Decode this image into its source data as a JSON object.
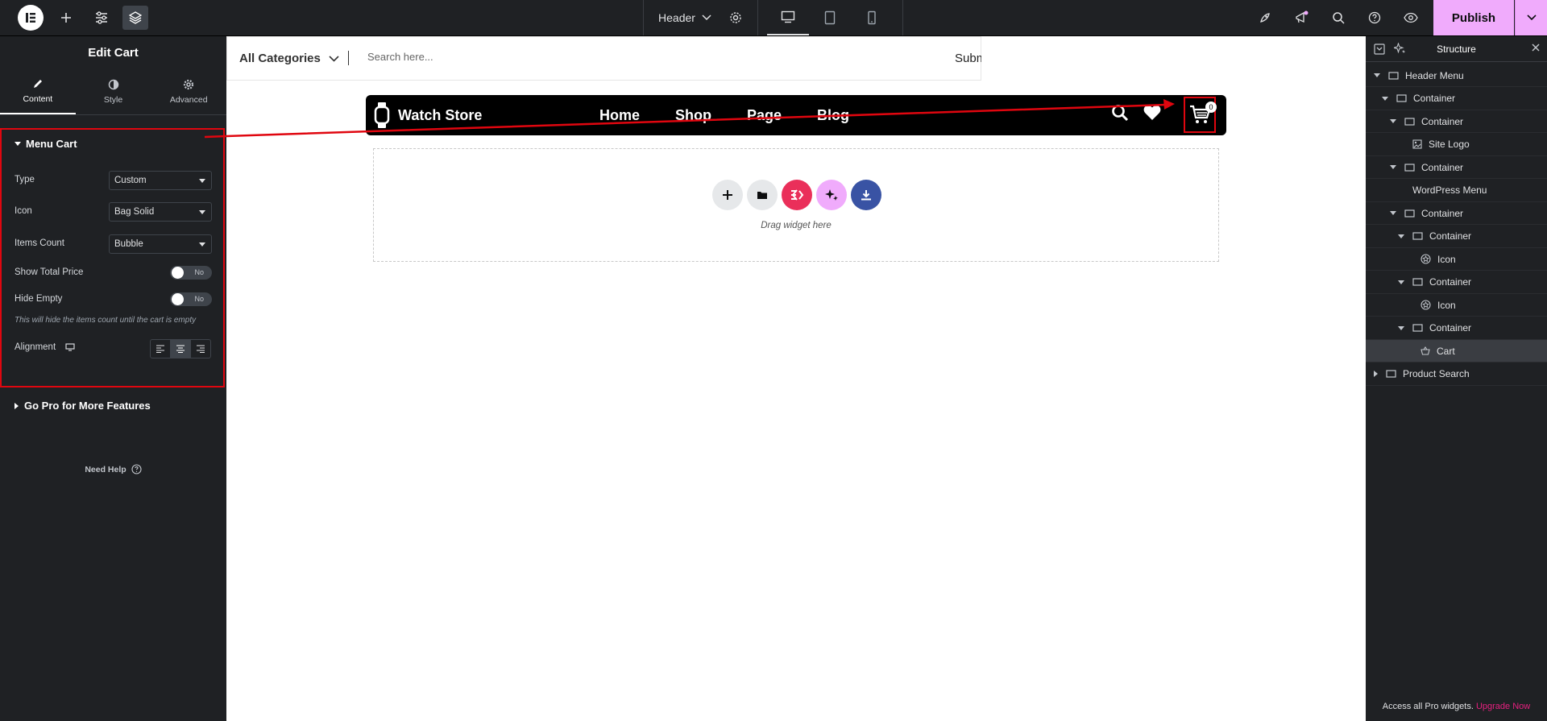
{
  "topbar": {
    "document_name": "Header",
    "publish_label": "Publish"
  },
  "panel": {
    "title": "Edit Cart",
    "tabs": [
      {
        "label": "Content",
        "icon": "pencil-icon",
        "active": true
      },
      {
        "label": "Style",
        "icon": "half-circle-icon",
        "active": false
      },
      {
        "label": "Advanced",
        "icon": "gear-icon",
        "active": false
      }
    ],
    "section_title": "Menu Cart",
    "controls": {
      "type_label": "Type",
      "type_value": "Custom",
      "icon_label": "Icon",
      "icon_value": "Bag Solid",
      "items_count_label": "Items Count",
      "items_count_value": "Bubble",
      "show_total_price_label": "Show Total Price",
      "show_total_price_value": "No",
      "hide_empty_label": "Hide Empty",
      "hide_empty_value": "No",
      "hide_empty_description": "This will hide the items count until the cart is empty",
      "alignment_label": "Alignment"
    },
    "gopro_label": "Go Pro for More Features",
    "need_help_label": "Need Help"
  },
  "canvas": {
    "search": {
      "category": "All Categories",
      "placeholder": "Search here...",
      "submit": "Submit"
    },
    "header": {
      "store_name": "Watch Store",
      "nav": [
        "Home",
        "Shop",
        "Page",
        "Blog"
      ],
      "cart_count": "0"
    },
    "drop_text": "Drag widget here"
  },
  "structure": {
    "title": "Structure",
    "nodes": [
      {
        "label": "Header Menu",
        "depth": 0,
        "caret": "down",
        "icon": "container-icon"
      },
      {
        "label": "Container",
        "depth": 1,
        "caret": "down",
        "icon": "container-icon"
      },
      {
        "label": "Container",
        "depth": 2,
        "caret": "down",
        "icon": "container-icon"
      },
      {
        "label": "Site Logo",
        "depth": 3,
        "caret": "none",
        "icon": "site-logo-icon"
      },
      {
        "label": "Container",
        "depth": 2,
        "caret": "down",
        "icon": "container-icon"
      },
      {
        "label": "WordPress Menu",
        "depth": 3,
        "caret": "none",
        "icon": "none"
      },
      {
        "label": "Container",
        "depth": 2,
        "caret": "down",
        "icon": "container-icon"
      },
      {
        "label": "Container",
        "depth": 3,
        "caret": "down",
        "icon": "container-icon"
      },
      {
        "label": "Icon",
        "depth": 4,
        "caret": "none",
        "icon": "star-circle-icon"
      },
      {
        "label": "Container",
        "depth": 3,
        "caret": "down",
        "icon": "container-icon"
      },
      {
        "label": "Icon",
        "depth": 4,
        "caret": "none",
        "icon": "star-circle-icon"
      },
      {
        "label": "Container",
        "depth": 3,
        "caret": "down",
        "icon": "container-icon"
      },
      {
        "label": "Cart",
        "depth": 4,
        "caret": "none",
        "icon": "basket-icon",
        "selected": true
      },
      {
        "label": "Product Search",
        "depth": 0,
        "caret": "right",
        "icon": "container-icon"
      }
    ],
    "footer_text": "Access all Pro widgets.",
    "footer_link": "Upgrade Now"
  },
  "colors": {
    "panel_bg": "#1f2124",
    "publish_bg": "#f0abfc",
    "annotation_red": "#e0060f",
    "header_bar": "#000000",
    "upgrade_link": "#e6217f"
  }
}
